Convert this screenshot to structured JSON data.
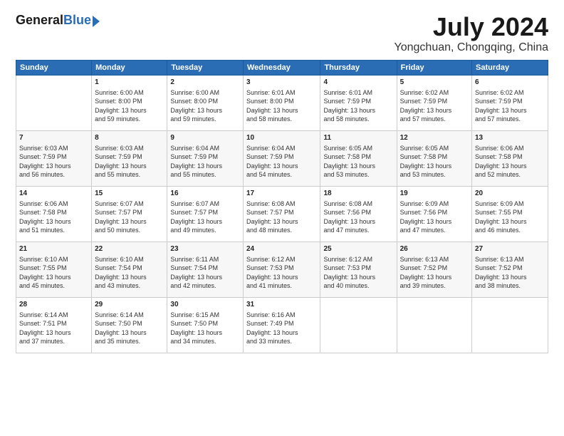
{
  "logo": {
    "general": "General",
    "blue": "Blue"
  },
  "title": "July 2024",
  "location": "Yongchuan, Chongqing, China",
  "headers": [
    "Sunday",
    "Monday",
    "Tuesday",
    "Wednesday",
    "Thursday",
    "Friday",
    "Saturday"
  ],
  "weeks": [
    [
      {
        "day": "",
        "content": ""
      },
      {
        "day": "1",
        "content": "Sunrise: 6:00 AM\nSunset: 8:00 PM\nDaylight: 13 hours\nand 59 minutes."
      },
      {
        "day": "2",
        "content": "Sunrise: 6:00 AM\nSunset: 8:00 PM\nDaylight: 13 hours\nand 59 minutes."
      },
      {
        "day": "3",
        "content": "Sunrise: 6:01 AM\nSunset: 8:00 PM\nDaylight: 13 hours\nand 58 minutes."
      },
      {
        "day": "4",
        "content": "Sunrise: 6:01 AM\nSunset: 7:59 PM\nDaylight: 13 hours\nand 58 minutes."
      },
      {
        "day": "5",
        "content": "Sunrise: 6:02 AM\nSunset: 7:59 PM\nDaylight: 13 hours\nand 57 minutes."
      },
      {
        "day": "6",
        "content": "Sunrise: 6:02 AM\nSunset: 7:59 PM\nDaylight: 13 hours\nand 57 minutes."
      }
    ],
    [
      {
        "day": "7",
        "content": "Sunrise: 6:03 AM\nSunset: 7:59 PM\nDaylight: 13 hours\nand 56 minutes."
      },
      {
        "day": "8",
        "content": "Sunrise: 6:03 AM\nSunset: 7:59 PM\nDaylight: 13 hours\nand 55 minutes."
      },
      {
        "day": "9",
        "content": "Sunrise: 6:04 AM\nSunset: 7:59 PM\nDaylight: 13 hours\nand 55 minutes."
      },
      {
        "day": "10",
        "content": "Sunrise: 6:04 AM\nSunset: 7:59 PM\nDaylight: 13 hours\nand 54 minutes."
      },
      {
        "day": "11",
        "content": "Sunrise: 6:05 AM\nSunset: 7:58 PM\nDaylight: 13 hours\nand 53 minutes."
      },
      {
        "day": "12",
        "content": "Sunrise: 6:05 AM\nSunset: 7:58 PM\nDaylight: 13 hours\nand 53 minutes."
      },
      {
        "day": "13",
        "content": "Sunrise: 6:06 AM\nSunset: 7:58 PM\nDaylight: 13 hours\nand 52 minutes."
      }
    ],
    [
      {
        "day": "14",
        "content": "Sunrise: 6:06 AM\nSunset: 7:58 PM\nDaylight: 13 hours\nand 51 minutes."
      },
      {
        "day": "15",
        "content": "Sunrise: 6:07 AM\nSunset: 7:57 PM\nDaylight: 13 hours\nand 50 minutes."
      },
      {
        "day": "16",
        "content": "Sunrise: 6:07 AM\nSunset: 7:57 PM\nDaylight: 13 hours\nand 49 minutes."
      },
      {
        "day": "17",
        "content": "Sunrise: 6:08 AM\nSunset: 7:57 PM\nDaylight: 13 hours\nand 48 minutes."
      },
      {
        "day": "18",
        "content": "Sunrise: 6:08 AM\nSunset: 7:56 PM\nDaylight: 13 hours\nand 47 minutes."
      },
      {
        "day": "19",
        "content": "Sunrise: 6:09 AM\nSunset: 7:56 PM\nDaylight: 13 hours\nand 47 minutes."
      },
      {
        "day": "20",
        "content": "Sunrise: 6:09 AM\nSunset: 7:55 PM\nDaylight: 13 hours\nand 46 minutes."
      }
    ],
    [
      {
        "day": "21",
        "content": "Sunrise: 6:10 AM\nSunset: 7:55 PM\nDaylight: 13 hours\nand 45 minutes."
      },
      {
        "day": "22",
        "content": "Sunrise: 6:10 AM\nSunset: 7:54 PM\nDaylight: 13 hours\nand 43 minutes."
      },
      {
        "day": "23",
        "content": "Sunrise: 6:11 AM\nSunset: 7:54 PM\nDaylight: 13 hours\nand 42 minutes."
      },
      {
        "day": "24",
        "content": "Sunrise: 6:12 AM\nSunset: 7:53 PM\nDaylight: 13 hours\nand 41 minutes."
      },
      {
        "day": "25",
        "content": "Sunrise: 6:12 AM\nSunset: 7:53 PM\nDaylight: 13 hours\nand 40 minutes."
      },
      {
        "day": "26",
        "content": "Sunrise: 6:13 AM\nSunset: 7:52 PM\nDaylight: 13 hours\nand 39 minutes."
      },
      {
        "day": "27",
        "content": "Sunrise: 6:13 AM\nSunset: 7:52 PM\nDaylight: 13 hours\nand 38 minutes."
      }
    ],
    [
      {
        "day": "28",
        "content": "Sunrise: 6:14 AM\nSunset: 7:51 PM\nDaylight: 13 hours\nand 37 minutes."
      },
      {
        "day": "29",
        "content": "Sunrise: 6:14 AM\nSunset: 7:50 PM\nDaylight: 13 hours\nand 35 minutes."
      },
      {
        "day": "30",
        "content": "Sunrise: 6:15 AM\nSunset: 7:50 PM\nDaylight: 13 hours\nand 34 minutes."
      },
      {
        "day": "31",
        "content": "Sunrise: 6:16 AM\nSunset: 7:49 PM\nDaylight: 13 hours\nand 33 minutes."
      },
      {
        "day": "",
        "content": ""
      },
      {
        "day": "",
        "content": ""
      },
      {
        "day": "",
        "content": ""
      }
    ]
  ]
}
